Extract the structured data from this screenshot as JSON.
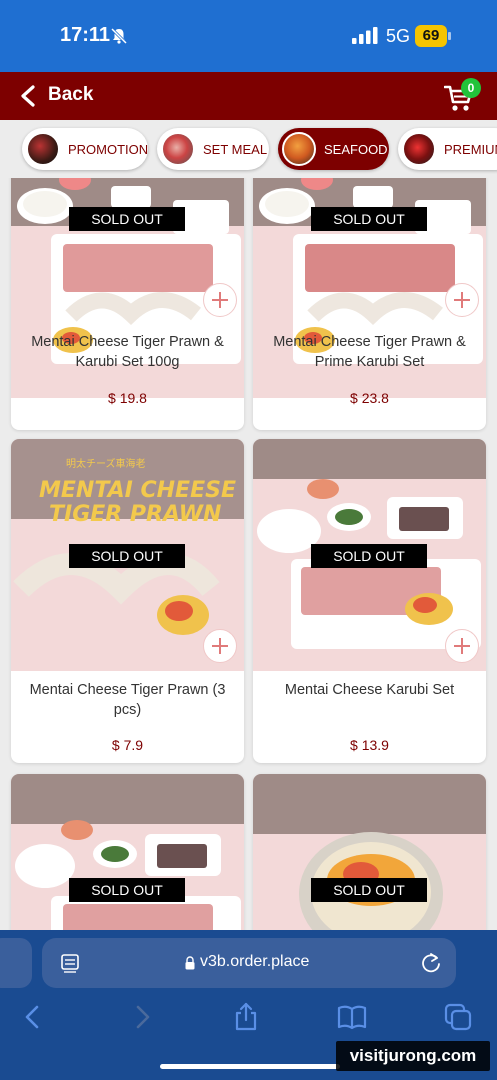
{
  "status_bar": {
    "time": "17:11",
    "network": "5G",
    "battery": "69"
  },
  "header": {
    "back_label": "Back",
    "cart_count": "0"
  },
  "categories": [
    {
      "label": "PROMOTION",
      "active": false
    },
    {
      "label": "SET MEAL",
      "active": false
    },
    {
      "label": "SEAFOOD",
      "active": true
    },
    {
      "label": "PREMIUM",
      "active": false
    }
  ],
  "products": [
    {
      "name": "Mentai Cheese Tiger Prawn & Karubi Set 100g",
      "price": "$ 19.8",
      "status": "SOLD OUT"
    },
    {
      "name": "Mentai Cheese Tiger Prawn & Prime Karubi Set",
      "price": "$ 23.8",
      "status": "SOLD OUT"
    },
    {
      "name": "Mentai Cheese Tiger Prawn (3 pcs)",
      "price": "$ 7.9",
      "status": "SOLD OUT",
      "image_text_jp": "明太チーズ車海老",
      "image_text_line1": "MENTAI CHEESE",
      "image_text_line2": "TIGER PRAWN"
    },
    {
      "name": "Mentai Cheese Karubi Set",
      "price": "$ 13.9",
      "status": "SOLD OUT"
    },
    {
      "name": "",
      "price": "",
      "status": "SOLD OUT"
    },
    {
      "name": "",
      "price": "",
      "status": "SOLD OUT"
    }
  ],
  "browser": {
    "url": "v3b.order.place"
  },
  "watermark": "visitjurong.com",
  "icons": {
    "status": [
      "bell-slash-icon",
      "signal-icon",
      "battery-icon"
    ],
    "header": [
      "chevron-left-icon",
      "cart-icon"
    ],
    "product": [
      "plus-icon"
    ],
    "browser": [
      "reader-icon",
      "lock-icon",
      "reload-icon",
      "back-arrow-icon",
      "forward-arrow-icon",
      "share-icon",
      "bookmarks-icon",
      "tabs-icon"
    ]
  },
  "colors": {
    "status_bar": "#1f6fd1",
    "brand": "#7d0000",
    "badge": "#22c33a",
    "battery": "#f5c400",
    "browser_bar": "#1a4b91",
    "sold_out_bg": "#000000"
  }
}
